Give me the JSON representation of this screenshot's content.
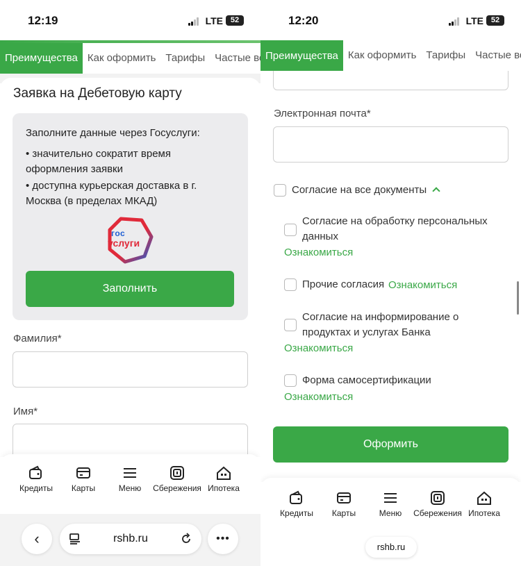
{
  "left": {
    "status": {
      "time": "12:19",
      "network": "LTE",
      "battery": "52"
    },
    "tabs": [
      "Преимущества",
      "Как оформить",
      "Тарифы",
      "Частые вопросы"
    ],
    "form_title": "Заявка на Дебетовую карту",
    "gosuslugi": {
      "intro": "Заполните данные через Госуслуги:",
      "bullets": [
        "•  значительно сократит время оформления заявки",
        "•  доступна курьерская доставка в г. Москва (в пределах МКАД)"
      ],
      "logo_top": "гос",
      "logo_bottom": "услуги",
      "button": "Заполнить"
    },
    "fields": [
      {
        "label": "Фамилия*",
        "value": ""
      },
      {
        "label": "Имя*",
        "value": ""
      }
    ],
    "browser": {
      "url": "rshb.ru",
      "more": "•••",
      "back": "‹"
    }
  },
  "right": {
    "status": {
      "time": "12:20",
      "network": "LTE",
      "battery": "52"
    },
    "tabs": [
      "Преимущества",
      "Как оформить",
      "Тарифы",
      "Частые вопросы"
    ],
    "email_label": "Электронная почта*",
    "email_value": "",
    "consent_all": "Согласие на все документы",
    "consents": [
      {
        "text": "Согласие на обработку персональных данных",
        "link": "Ознакомиться"
      },
      {
        "text": "Прочие согласия",
        "link": "Ознакомиться"
      },
      {
        "text": "Согласие на информирование о продуктах и услугах Банка",
        "link": "Ознакомиться"
      },
      {
        "text": "Форма самосертификации",
        "link": "Ознакомиться"
      }
    ],
    "submit": "Оформить",
    "url": "rshb.ru"
  },
  "nav": [
    "Кредиты",
    "Карты",
    "Меню",
    "Сбережения",
    "Ипотека"
  ],
  "colors": {
    "accent": "#3aa847",
    "gos_blue": "#1e5ed3",
    "gos_red": "#e02a3a"
  }
}
